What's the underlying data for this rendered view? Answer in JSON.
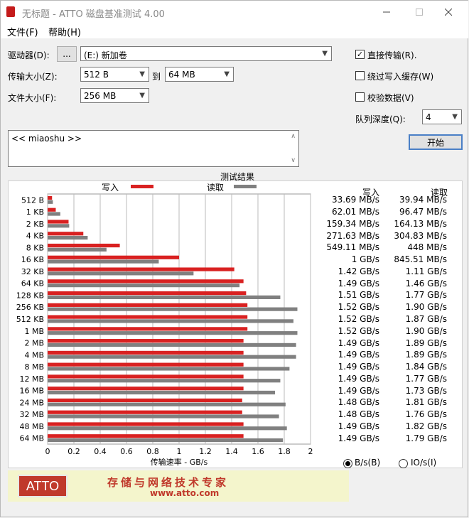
{
  "window": {
    "title": "无标题 - ATTO 磁盘基准测试 4.00",
    "title_icon": "app-icon"
  },
  "menu": {
    "file": "文件(F)",
    "help": "帮助(H)"
  },
  "controls": {
    "drive_label": "驱动器(D):",
    "browse_label": "...",
    "drive_value": "(E:) 新加卷",
    "transfer_label": "传输大小(Z):",
    "transfer_from": "512 B",
    "to_label": "到",
    "transfer_to": "64 MB",
    "file_size_label": "文件大小(F):",
    "file_size": "256 MB",
    "direct_io_label": "直接传输(R).",
    "direct_io_checked": true,
    "bypass_cache_label": "绕过写入缓存(W)",
    "bypass_cache_checked": false,
    "verify_label": "校验数据(V)",
    "verify_checked": false,
    "queue_label": "队列深度(Q):",
    "queue_value": "4",
    "start_label": "开始",
    "description": "<< miaoshu >>"
  },
  "results": {
    "title": "测试结果",
    "write_header": "写入",
    "read_header": "读取",
    "units_bs": "B/s(B)",
    "units_ios": "IO/s(I)",
    "selected_units": "B/s"
  },
  "colors": {
    "write": "#d92121",
    "read": "#808080",
    "banner_bg": "#f4f5cc",
    "logo_bg": "#c0392b",
    "banner_text": "#c0392b"
  },
  "banner": {
    "logo": "ATTO",
    "slogan": "存储与网络技术专家",
    "url": "www.atto.com"
  },
  "chart_data": {
    "type": "bar",
    "orientation": "horizontal",
    "categories": [
      "512 B",
      "1 KB",
      "2 KB",
      "4 KB",
      "8 KB",
      "16 KB",
      "32 KB",
      "64 KB",
      "128 KB",
      "256 KB",
      "512 KB",
      "1 MB",
      "2 MB",
      "4 MB",
      "8 MB",
      "12 MB",
      "16 MB",
      "24 MB",
      "32 MB",
      "48 MB",
      "64 MB"
    ],
    "series": [
      {
        "name": "写入",
        "color": "#d92121",
        "values": [
          0.03369,
          0.06201,
          0.15934,
          0.27163,
          0.54911,
          1.0,
          1.42,
          1.49,
          1.51,
          1.52,
          1.52,
          1.52,
          1.49,
          1.49,
          1.49,
          1.49,
          1.49,
          1.48,
          1.48,
          1.49,
          1.49
        ]
      },
      {
        "name": "读取",
        "color": "#808080",
        "values": [
          0.03994,
          0.09647,
          0.16413,
          0.30483,
          0.448,
          0.84551,
          1.11,
          1.46,
          1.77,
          1.9,
          1.87,
          1.9,
          1.89,
          1.89,
          1.84,
          1.77,
          1.73,
          1.81,
          1.76,
          1.82,
          1.79
        ]
      }
    ],
    "write_labels": [
      "33.69 MB/s",
      "62.01 MB/s",
      "159.34 MB/s",
      "271.63 MB/s",
      "549.11 MB/s",
      "1 GB/s",
      "1.42 GB/s",
      "1.49 GB/s",
      "1.51 GB/s",
      "1.52 GB/s",
      "1.52 GB/s",
      "1.52 GB/s",
      "1.49 GB/s",
      "1.49 GB/s",
      "1.49 GB/s",
      "1.49 GB/s",
      "1.49 GB/s",
      "1.48 GB/s",
      "1.48 GB/s",
      "1.49 GB/s",
      "1.49 GB/s"
    ],
    "read_labels": [
      "39.94 MB/s",
      "96.47 MB/s",
      "164.13 MB/s",
      "304.83 MB/s",
      "448 MB/s",
      "845.51 MB/s",
      "1.11 GB/s",
      "1.46 GB/s",
      "1.77 GB/s",
      "1.90 GB/s",
      "1.87 GB/s",
      "1.90 GB/s",
      "1.89 GB/s",
      "1.89 GB/s",
      "1.84 GB/s",
      "1.77 GB/s",
      "1.73 GB/s",
      "1.81 GB/s",
      "1.76 GB/s",
      "1.82 GB/s",
      "1.79 GB/s"
    ],
    "xlabel": "传输速率 - GB/s",
    "xlim": [
      0,
      2
    ],
    "xticks": [
      "0",
      "0.2",
      "0.4",
      "0.6",
      "0.8",
      "1",
      "1.2",
      "1.4",
      "1.6",
      "1.8",
      "2"
    ],
    "grid": true
  }
}
